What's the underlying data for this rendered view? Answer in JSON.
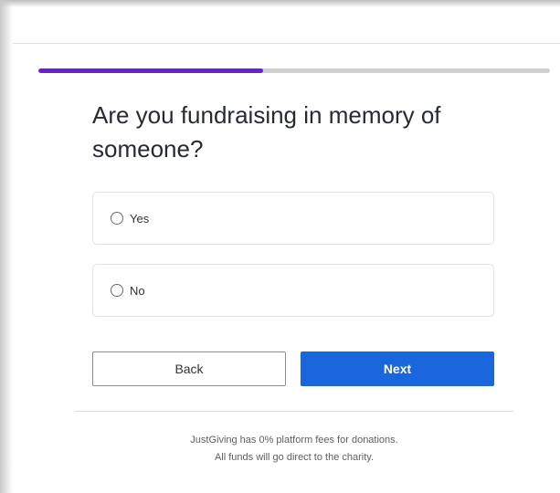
{
  "progress": {
    "fraction": 0.44,
    "track_color": "#d0d0d0",
    "fill_color": "#6a1fd1"
  },
  "question": {
    "title": "Are you fundraising in memory of someone?"
  },
  "options": [
    {
      "label": "Yes",
      "selected": false
    },
    {
      "label": "No",
      "selected": false
    }
  ],
  "buttons": {
    "back_label": "Back",
    "next_label": "Next",
    "next_color": "#1a66dc"
  },
  "footer": {
    "line1": "JustGiving has 0% platform fees for donations.",
    "line2": "All funds will go direct to the charity."
  }
}
